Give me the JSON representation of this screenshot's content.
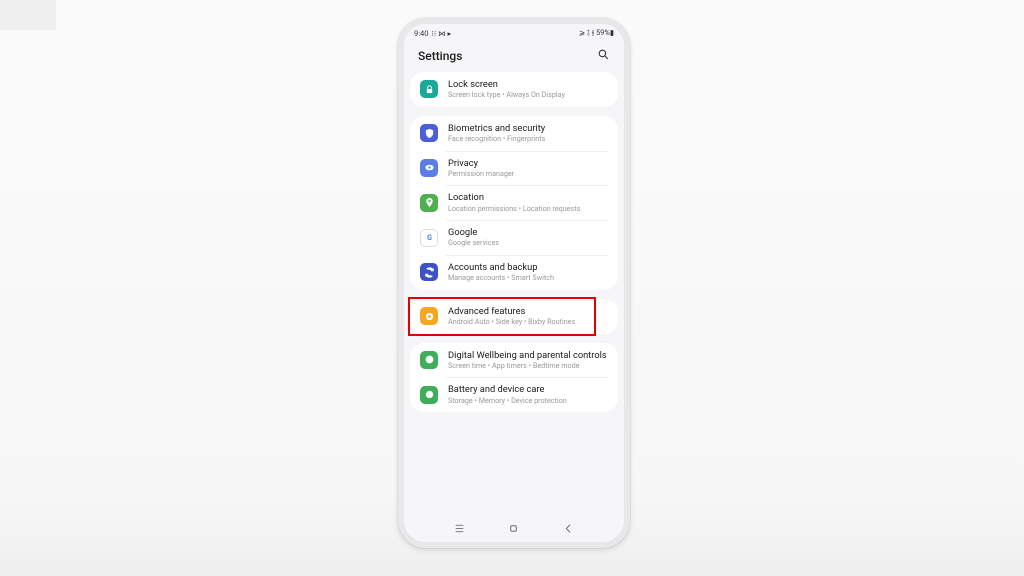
{
  "status_bar": {
    "time": "9:40",
    "left_indicators": "⁝⁝ ⋈ ▸",
    "right_indicators": "⩾ ⫱ ⫲ 59%▮"
  },
  "header": {
    "title": "Settings"
  },
  "groups": [
    {
      "items": [
        {
          "id": "lock-screen",
          "title": "Lock screen",
          "sub": "Screen lock type • Always On Display",
          "color": "#1aa89a",
          "icon": "lock"
        }
      ]
    },
    {
      "items": [
        {
          "id": "biometrics",
          "title": "Biometrics and security",
          "sub": "Face recognition • Fingerprints",
          "color": "#4a5fd8",
          "icon": "shield"
        },
        {
          "id": "privacy",
          "title": "Privacy",
          "sub": "Permission manager",
          "color": "#5b7ee6",
          "icon": "eye"
        },
        {
          "id": "location",
          "title": "Location",
          "sub": "Location permissions • Location requests",
          "color": "#4fb04f",
          "icon": "pin"
        },
        {
          "id": "google",
          "title": "Google",
          "sub": "Google services",
          "color": "#ffffff",
          "icon": "google"
        },
        {
          "id": "accounts",
          "title": "Accounts and backup",
          "sub": "Manage accounts • Smart Switch",
          "color": "#3c52c9",
          "icon": "sync"
        }
      ]
    },
    {
      "items": [
        {
          "id": "advanced",
          "title": "Advanced features",
          "sub": "Android Auto • Side key • Bixby Routines",
          "color": "#f5a623",
          "icon": "gear",
          "highlighted": true
        }
      ]
    },
    {
      "items": [
        {
          "id": "wellbeing",
          "title": "Digital Wellbeing and parental controls",
          "sub": "Screen time • App timers • Bedtime mode",
          "color": "#3fae5a",
          "icon": "circle"
        },
        {
          "id": "battery",
          "title": "Battery and device care",
          "sub": "Storage • Memory • Device protection",
          "color": "#3fae5a",
          "icon": "heart"
        }
      ]
    }
  ]
}
